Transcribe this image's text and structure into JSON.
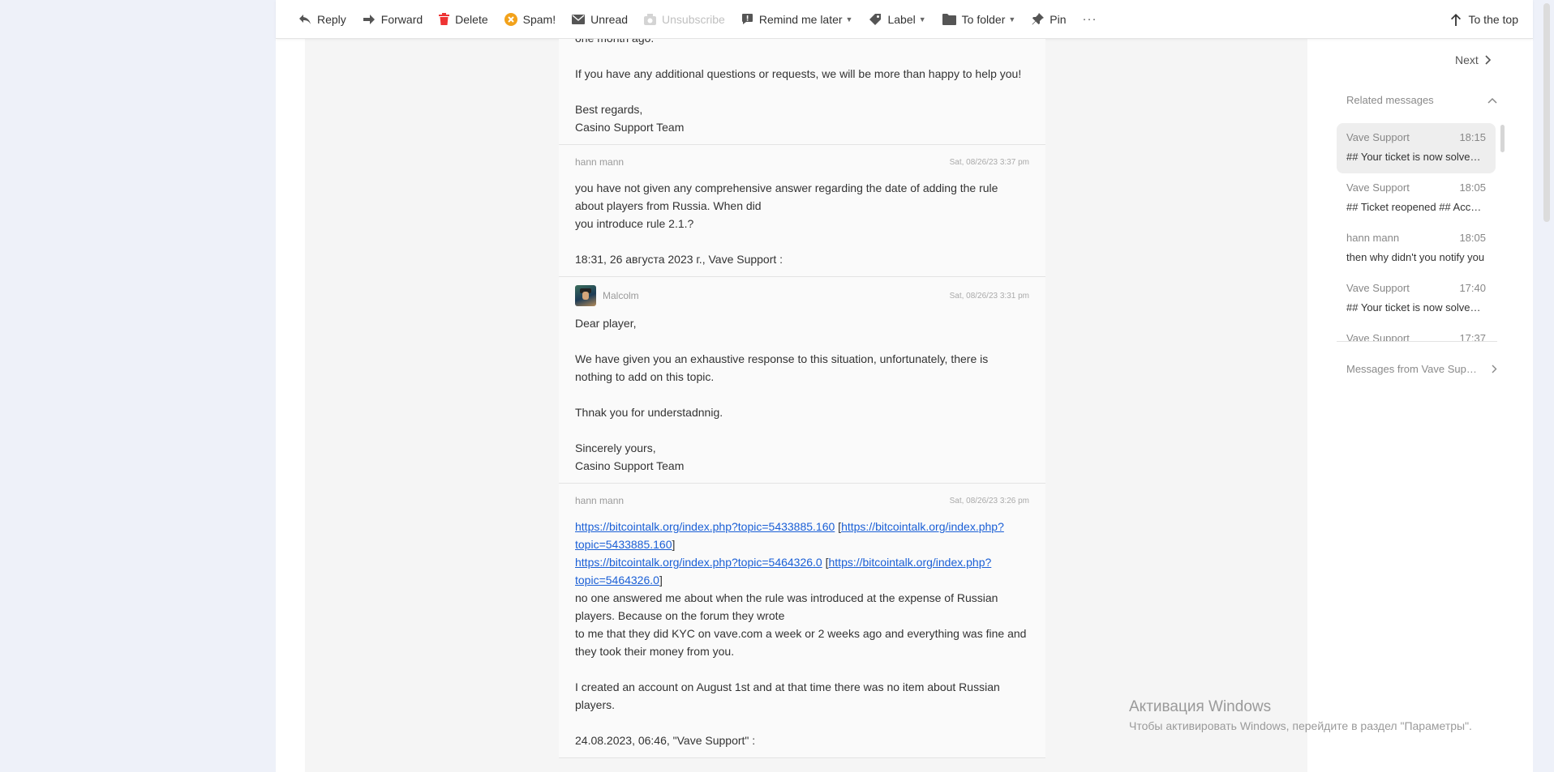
{
  "toolbar": {
    "reply": "Reply",
    "forward": "Forward",
    "delete": "Delete",
    "spam": "Spam!",
    "unread": "Unread",
    "unsubscribe": "Unsubscribe",
    "remind": "Remind me later",
    "label": "Label",
    "to_folder": "To folder",
    "pin": "Pin",
    "more": "···",
    "to_top": "To the top"
  },
  "messages": {
    "m0": {
      "lines": [
        "one month ago.",
        "If you have any additional questions or requests, we will be more than happy to help you!",
        "Best regards,",
        "Casino Support Team"
      ]
    },
    "m1": {
      "sender": "hann mann",
      "date": "Sat, 08/26/23 3:37 pm",
      "lines": [
        "you have not given any comprehensive answer regarding the date of adding the rule",
        "about players from Russia. When did",
        "you introduce rule 2.1.?",
        "18:31, 26 августа 2023 г., Vave Support :"
      ]
    },
    "m2": {
      "sender": "Malcolm",
      "date": "Sat, 08/26/23 3:31 pm",
      "lines": [
        "Dear player,",
        "We have given you an exhaustive response to this situation, unfortunately, there is",
        "nothing to add on this topic.",
        "Thnak you for understadnnig.",
        "Sincerely yours,",
        "Casino Support Team"
      ]
    },
    "m3": {
      "sender": "hann mann",
      "date": "Sat, 08/26/23 3:26 pm",
      "link1": "https://bitcointalk.org/index.php?topic=5433885.160",
      "link1b_a": "https://bitcointalk.org/index.php?",
      "link1b_b": "topic=5433885.160",
      "link2": "https://bitcointalk.org/index.php?topic=5464326.0",
      "link2b_a": "https://bitcointalk.org/index.php?",
      "link2b_b": "topic=5464326.0",
      "bracket_open": " [",
      "bracket_close": "]",
      "lines": [
        "no one answered me about when the rule was introduced at the expense of Russian",
        "players. Because on the forum they wrote",
        "to me that they did KYC on vave.com a week or 2 weeks ago and everything was fine and",
        "they took their money from you.",
        "I created an account on August 1st and at that time there was no item about Russian",
        "players.",
        "24.08.2023, 06:46, \"Vave Support\" :"
      ]
    }
  },
  "sidebar": {
    "next": "Next",
    "related_title": "Related messages",
    "related": [
      {
        "sender": "Vave Support",
        "time": "18:15",
        "preview": "## Your ticket is now solved ##"
      },
      {
        "sender": "Vave Support",
        "time": "18:05",
        "preview": "## Ticket reopened ## Accepted"
      },
      {
        "sender": "hann mann",
        "time": "18:05",
        "preview": "then why didn't you notify you"
      },
      {
        "sender": "Vave Support",
        "time": "17:40",
        "preview": "## Your ticket is now solved ##"
      },
      {
        "sender": "Vave Support",
        "time": "17:37",
        "preview": ""
      }
    ],
    "more_from": "Messages from Vave Support"
  },
  "activation": {
    "title": "Активация Windows",
    "subtitle": "Чтобы активировать Windows, перейдите в раздел \"Параметры\"."
  }
}
